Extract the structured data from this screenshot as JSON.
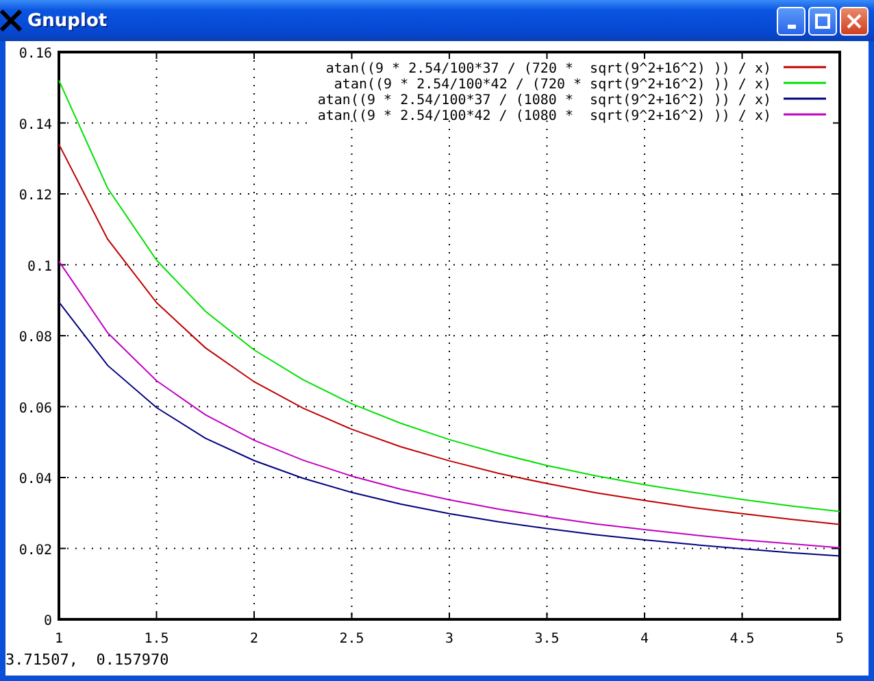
{
  "window": {
    "title": "Gnuplot"
  },
  "plot": {
    "chart_data": {
      "type": "line",
      "grid": true,
      "legend": true,
      "x": [
        1,
        1.25,
        1.5,
        1.75,
        2,
        2.25,
        2.5,
        2.75,
        3,
        3.25,
        3.5,
        3.75,
        4,
        4.25,
        4.5,
        4.75,
        5
      ],
      "xlim": [
        1,
        5
      ],
      "ylim": [
        0,
        0.16
      ],
      "xticks": [
        {
          "value": 1,
          "label": "1"
        },
        {
          "value": 1.5,
          "label": "1.5"
        },
        {
          "value": 2,
          "label": "2"
        },
        {
          "value": 2.5,
          "label": "2.5"
        },
        {
          "value": 3,
          "label": "3"
        },
        {
          "value": 3.5,
          "label": "3.5"
        },
        {
          "value": 4,
          "label": "4"
        },
        {
          "value": 4.5,
          "label": "4.5"
        },
        {
          "value": 5,
          "label": "5"
        }
      ],
      "yticks": [
        {
          "value": 0,
          "label": "0"
        },
        {
          "value": 0.02,
          "label": "0.02"
        },
        {
          "value": 0.04,
          "label": "0.04"
        },
        {
          "value": 0.06,
          "label": "0.06"
        },
        {
          "value": 0.08,
          "label": "0.08"
        },
        {
          "value": 0.1,
          "label": "0.1"
        },
        {
          "value": 0.12,
          "label": "0.12"
        },
        {
          "value": 0.14,
          "label": "0.14"
        },
        {
          "value": 0.16,
          "label": "0.16"
        }
      ],
      "series": [
        {
          "name": "atan((9 * 2.54/100*37 / (720 *  sqrt(9^2+16^2) )) / x)",
          "color": "#c00000",
          "values": [
            0.134,
            0.1072,
            0.0893,
            0.0766,
            0.067,
            0.0596,
            0.0536,
            0.0487,
            0.0447,
            0.0412,
            0.0383,
            0.0357,
            0.0335,
            0.0315,
            0.0298,
            0.0282,
            0.0268
          ]
        },
        {
          "name": "atan((9 * 2.54/100*42 / (720 * sqrt(9^2+16^2) )) / x)",
          "color": "#00e000",
          "values": [
            0.152,
            0.1216,
            0.1013,
            0.0869,
            0.076,
            0.0676,
            0.0608,
            0.0553,
            0.0507,
            0.0468,
            0.0434,
            0.0405,
            0.038,
            0.0358,
            0.0338,
            0.032,
            0.0304
          ]
        },
        {
          "name": "atan((9 * 2.54/100*37 / (1080 *  sqrt(9^2+16^2) )) / x)",
          "color": "#000080",
          "values": [
            0.0895,
            0.0716,
            0.0597,
            0.0511,
            0.0448,
            0.0398,
            0.0358,
            0.0325,
            0.0298,
            0.0275,
            0.0256,
            0.0239,
            0.0224,
            0.0211,
            0.0199,
            0.0188,
            0.0179
          ]
        },
        {
          "name": "atan((9 * 2.54/100*42 / (1080 *  sqrt(9^2+16^2) )) / x)",
          "color": "#c000c0",
          "values": [
            0.101,
            0.0808,
            0.0673,
            0.0577,
            0.0505,
            0.0449,
            0.0404,
            0.0367,
            0.0337,
            0.0311,
            0.0289,
            0.0269,
            0.0253,
            0.0238,
            0.0224,
            0.0213,
            0.0202
          ]
        }
      ]
    }
  },
  "status_bar": {
    "text": "3.71507,  0.157970"
  }
}
